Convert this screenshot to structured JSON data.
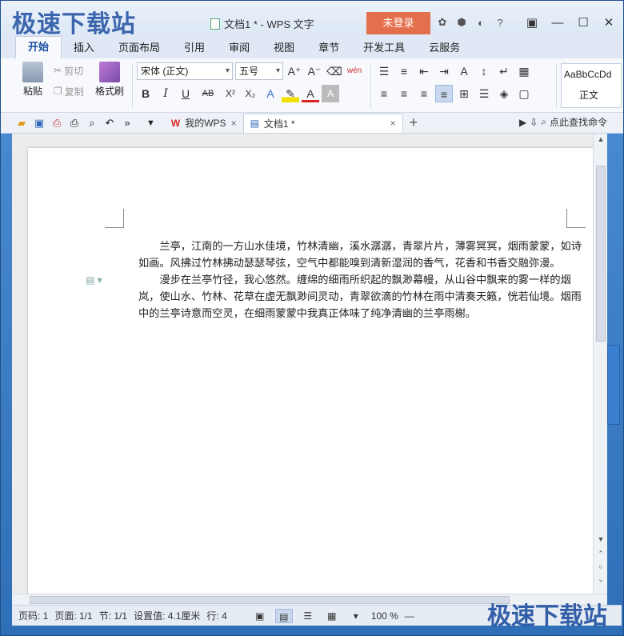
{
  "titlebar": {
    "watermark": "极速下载站",
    "doc_title": "文档1 * - WPS 文字",
    "login": "未登录",
    "icons": [
      "skin-icon",
      "cube-icon",
      "share-icon",
      "help-icon"
    ],
    "help": "?",
    "win": {
      "restore": "▣",
      "minimize": "—",
      "maximize": "☐",
      "close": "✕"
    }
  },
  "tabs": [
    "开始",
    "插入",
    "页面布局",
    "引用",
    "审阅",
    "视图",
    "章节",
    "开发工具",
    "云服务"
  ],
  "ribbon": {
    "paste": "粘贴",
    "cut": "剪切",
    "copy": "复制",
    "format_painter": "格式刷",
    "font_name": "宋体 (正文)",
    "font_size": "五号",
    "bold": "B",
    "italic": "I",
    "underline": "U",
    "strike": "AB",
    "superscript": "X²",
    "subscript": "X₂",
    "grow": "A⁺",
    "shrink": "A⁻",
    "pinyin": "wén",
    "style_preview": "AaBbCcDd",
    "style_name": "正文"
  },
  "doc_tabs": {
    "my_wps": "我的WPS",
    "doc1": "文档1 *",
    "close": "×",
    "add": "+",
    "find_cmd": "点此查找命令"
  },
  "document": {
    "paragraphs": [
      "兰亭，江南的一方山水佳境，竹林清幽，溪水潺潺，青翠片片，薄雾冥冥，烟雨蒙蒙，如诗如画。风拂过竹林拂动瑟瑟琴弦，空气中都能嗅到清新湿润的香气，花香和书香交融弥漫。",
      "漫步在兰亭竹径，我心悠然。缠绵的细雨所织起的飘渺幕幔，从山谷中飘来的雾一样的烟岚，使山水、竹林、花草在虚无飘渺间灵动，青翠欲滴的竹林在雨中清奏天籁，恍若仙境。烟雨中的兰亭诗意而空灵，在细雨蒙蒙中我真正体味了纯净清幽的兰亭雨榭。"
    ]
  },
  "status": {
    "page_no": "页码: 1",
    "pages": "页面: 1/1",
    "section": "节: 1/1",
    "setting": "设置值: 4.1厘米",
    "line": "行: 4",
    "zoom": "100 %",
    "zoom_minus": "—"
  }
}
